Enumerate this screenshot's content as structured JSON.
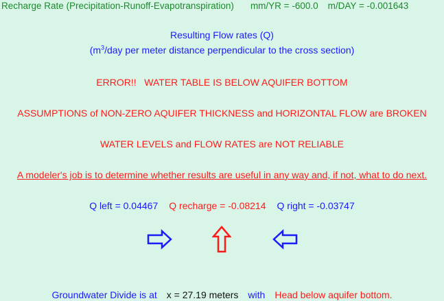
{
  "recharge": {
    "label": "Recharge Rate (Precipitation-Runoff-Evapotranspiration)",
    "mm_yr": "mm/YR = -600.0",
    "m_day": "m/DAY = -0.001643"
  },
  "flow": {
    "title": "Resulting Flow rates (Q)",
    "units_prefix": "(m",
    "units_sup": "3",
    "units_suffix": "/day per meter distance perpendicular to the cross section)"
  },
  "messages": {
    "error": "ERROR!!   WATER TABLE IS BELOW AQUIFER BOTTOM",
    "assumptions": "ASSUMPTIONS of NON-ZERO AQUIFER THICKNESS and HORIZONTAL FLOW are BROKEN",
    "reliability": "WATER LEVELS and FLOW RATES are NOT RELIABLE",
    "modeler": "A modeler's job is to determine whether results are useful in any way and, if not, what to do next."
  },
  "q_values": {
    "left": "Q left = 0.04467",
    "recharge": "Q recharge = -0.08214",
    "right": "Q right = -0.03747"
  },
  "arrows": {
    "left": "arrow-right-icon",
    "recharge": "arrow-up-icon",
    "right": "arrow-left-icon"
  },
  "divide": {
    "prefix": "Groundwater Divide is at",
    "position": "x = 27.19 meters",
    "with": "with",
    "head": "Head below aquifer bottom."
  },
  "colors": {
    "background": "#d9f5e8",
    "green": "#1a8a2a",
    "blue": "#1a1aff",
    "red": "#ff1a1a"
  }
}
